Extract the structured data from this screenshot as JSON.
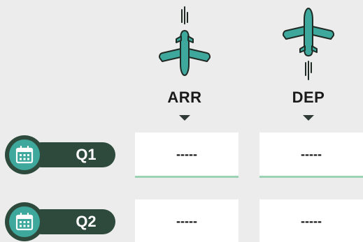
{
  "columns": [
    {
      "label": "ARR",
      "icon": "airplane-arriving-icon"
    },
    {
      "label": "DEP",
      "icon": "airplane-departing-icon"
    }
  ],
  "rows": [
    {
      "label": "Q1",
      "icon": "calendar-icon",
      "arr_value": "-----",
      "dep_value": "-----"
    },
    {
      "label": "Q2",
      "icon": "calendar-icon",
      "arr_value": "-----",
      "dep_value": "-----"
    }
  ],
  "colors": {
    "background": "#ececec",
    "pill_dark": "#2d4a3d",
    "teal": "#3fa89c",
    "cell_border": "#9cd3b4",
    "plane_outline": "#1f2a24"
  }
}
